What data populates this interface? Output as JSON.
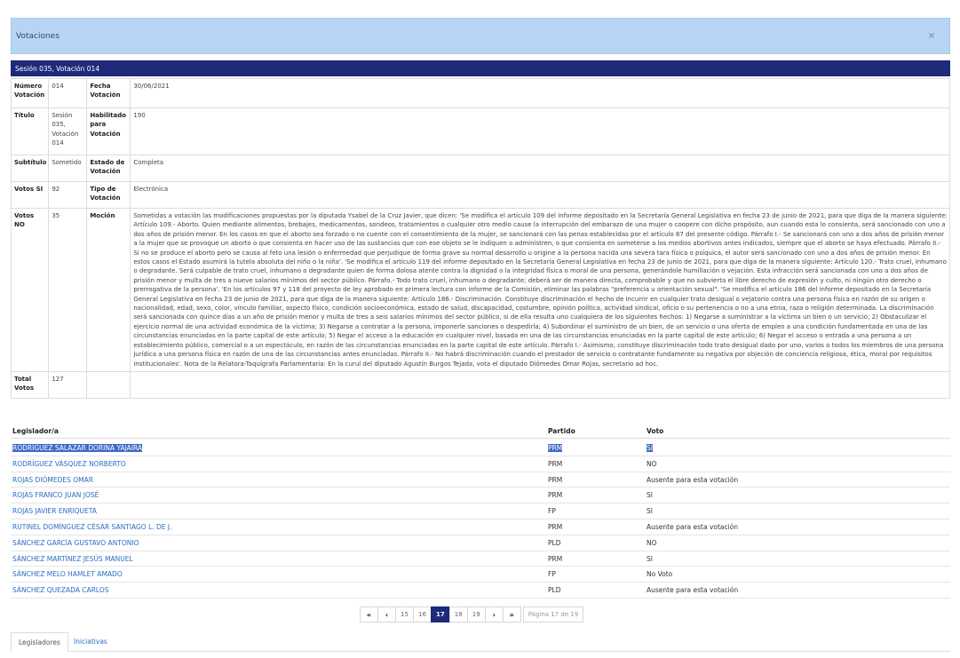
{
  "modal": {
    "title": "Votaciones",
    "close_label": "×"
  },
  "session_header": "Sesión 035, Votación 014",
  "details": {
    "numero_votacion": {
      "label": "Número Votación",
      "value": "014"
    },
    "fecha_votacion": {
      "label": "Fecha Votación",
      "value": "30/06/2021"
    },
    "titulo": {
      "label": "Título",
      "value": "Sesión 035, Votación 014"
    },
    "habilitado": {
      "label": "Habilitado para Votación",
      "value": "190"
    },
    "subtitulo": {
      "label": "Subtítulo",
      "value": "Sometido"
    },
    "estado": {
      "label": "Estado de Votación",
      "value": "Completa"
    },
    "votos_si": {
      "label": "Votos SI",
      "value": "92"
    },
    "tipo": {
      "label": "Tipo de Votación",
      "value": "Electrónica"
    },
    "votos_no": {
      "label": "Votos NO",
      "value": "35"
    },
    "mocion": {
      "label": "Moción",
      "value": "Sometidas a votación las modificaciones propuestas por la diputada Ysabel de la Cruz Javier, que dicen: 'Se modifica el artículo 109 del informe depositado en la Secretaría General Legislativa en fecha 23 de junio de 2021, para que diga de la manera siguiente: Artículo 109.- Aborto. Quien mediante alimentos, brebajes, medicamentos, sondeos, tratamientos o cualquier otro medio cause la interrupción del embarazo de una mujer o coopere con dicho propósito, aun cuando esta lo consienta, será sancionado con uno a dos años de prisión menor. En los casos en que el aborto sea forzado o no cuente con el consentimiento de la mujer, se sancionará con las penas establecidas por el artículo 87 del presente código. Párrafo I.- Se sancionará con uno a dos años de prisión menor a la mujer que se provoque un aborto o que consienta en hacer uso de las sustancias que con ese objeto se le indiquen o administren, o que consienta en someterse a los medios abortivos antes indicados, siempre que el aborto se haya efectuado. Párrafo II.- Si no se produce el aborto pero se causa al feto una lesión o enfermedad que perjudique de forma grave su normal desarrollo u origine a la persona nacida una severa tara física o psíquica, el autor será sancionado con uno a dos años de prisión menor. En estos casos el Estado asumirá la tutela absoluta del niño o la niña'. 'Se modifica el artículo 119 del informe depositado en la Secretaría General Legislativa en fecha 23 de junio de 2021, para que diga de la manera siguiente: Artículo 120.- Trato cruel, inhumano o degradante. Será culpable de trato cruel, inhumano o degradante quien de forma dolosa atente contra la dignidad o la integridad física o moral de una persona, generándole humillación o vejación. Esta infracción será sancionada con uno a dos años de prisión menor y multa de tres a nueve salarios mínimos del sector público. Párrafo.- Todo trato cruel, inhumano o degradante; deberá ser de manera directa, comprobable y que no subvierta el libre derecho de expresión y culto, ni ningún otro derecho o prerrogativa de la persona'. 'En los artículos 97 y 118 del proyecto de ley aprobado en primera lectura con informe de la Comisión, eliminar las palabras \"preferencia u orientación sexual\". 'Se modifica el artículo 186 del informe depositado en la Secretaría General Legislativa en fecha 23 de junio de 2021, para que diga de la manera siguiente: Artículo 186.- Discriminación. Constituye discriminación el hecho de incurrir en cualquier trato desigual o vejatorio contra una persona física en razón de su origen o nacionalidad, edad, sexo, color, vínculo familiar, aspecto físico, condición socioeconómica, estado de salud, discapacidad, costumbre, opinión política, actividad sindical, oficio o su pertenencia o no a una etnia, raza o religión determinada. La discriminación será sancionada con quince días a un año de prisión menor y multa de tres a seis salarios mínimos del sector público, si de ella resulta uno cualquiera de los siguientes hechos: 1) Negarse a suministrar a la víctima un bien o un servicio; 2) Obstaculizar el ejercicio normal de una actividad económica de la víctima; 3) Negarse a contratar a la persona, imponerle sanciones o despedirla; 4) Subordinar el suministro de un bien, de un servicio o una oferta de empleo a una condición fundamentada en una de las circunstancias enunciadas en la parte capital de este artículo; 5) Negar el acceso a la educación en cualquier nivel, basada en una de las circunstancias enunciadas en la parte capital de este artículo; 6) Negar el acceso o entrada a una persona a un establecimiento público, comercial o a un espectáculo, en razón de las circunstancias enunciadas en la parte capital de este artículo. Párrafo I.- Asimismo, constituye discriminación todo trato desigual dado por uno, varios o todos los miembros de una persona jurídica a una persona física en razón de una de las circunstancias antes enunciadas. Párrafo II.- No habrá discriminación cuando el prestador de servicio o contratante fundamente su negativa por objeción de conciencia religiosa, ética, moral por requisitos institucionales'. Nota de la Relatora-Taquígrafa Parlamentaria: En la curul del diputado Agustín Burgos Tejada, vota el diputado Diómedes Omar Rojas, secretario ad hoc."
    },
    "total_votos": {
      "label": "Total Votos",
      "value": "127"
    }
  },
  "legislators": {
    "headers": {
      "name": "Legislador/a",
      "party": "Partido",
      "vote": "Voto"
    },
    "rows": [
      {
        "name": "RODRÍGUEZ SALAZAR DORINA YAJAIRA",
        "party": "PRM",
        "vote": "SI",
        "selected": true
      },
      {
        "name": "RODRÍGUEZ VÁSQUEZ NORBERTO",
        "party": "PRM",
        "vote": "NO"
      },
      {
        "name": "ROJAS DIÓMEDES OMAR",
        "party": "PRM",
        "vote": "Ausente para esta votación"
      },
      {
        "name": "ROJAS FRANCO JUAN JOSÉ",
        "party": "PRM",
        "vote": "SI"
      },
      {
        "name": "ROJAS JAVIER ENRIQUETA",
        "party": "FP",
        "vote": "SI"
      },
      {
        "name": "RUTINEL DOMÍNGUEZ CÉSAR SANTIAGO L. DE J.",
        "party": "PRM",
        "vote": "Ausente para esta votación"
      },
      {
        "name": "SÁNCHEZ GARCÍA GUSTAVO ANTONIO",
        "party": "PLD",
        "vote": "NO"
      },
      {
        "name": "SÁNCHEZ MARTÍNEZ JESÚS MANUEL",
        "party": "PRM",
        "vote": "SI"
      },
      {
        "name": "SÁNCHEZ MELO HAMLET AMADO",
        "party": "FP",
        "vote": "No Voto"
      },
      {
        "name": "SÁNCHEZ QUEZADA CARLOS",
        "party": "PLD",
        "vote": "Ausente para esta votación"
      }
    ]
  },
  "pagination": {
    "first_icon": "double-chevron-left-icon",
    "prev_icon": "chevron-left-icon",
    "next_icon": "chevron-right-icon",
    "last_icon": "double-chevron-right-icon",
    "first": "«",
    "prev": "‹",
    "next": "›",
    "last": "»",
    "pages": [
      "15",
      "16",
      "17",
      "18",
      "19"
    ],
    "current": "17",
    "info": "Página 17 de 19"
  },
  "tabs": {
    "legisladores": "Legisladores",
    "iniciativas": "Iniciativas"
  },
  "colors": {
    "header_bg": "#b8d4f5",
    "session_bar": "#1f2a7a",
    "link": "#2a6dc4",
    "selection": "#3f6ac6"
  }
}
